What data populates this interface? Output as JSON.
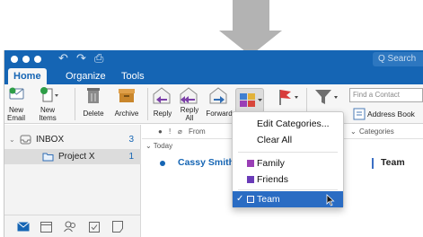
{
  "window": {
    "title_bar": {
      "search_placeholder": "Q  Search"
    },
    "tabs": [
      {
        "label": "Home"
      },
      {
        "label": "Organize"
      },
      {
        "label": "Tools"
      }
    ]
  },
  "ribbon": {
    "new_email": {
      "label1": "New",
      "label2": "Email"
    },
    "new_items": {
      "label1": "New",
      "label2": "Items"
    },
    "delete": {
      "label": "Delete"
    },
    "archive": {
      "label": "Archive"
    },
    "reply": {
      "label": "Reply"
    },
    "reply_all": {
      "label1": "Reply",
      "label2": "All"
    },
    "forward": {
      "label": "Forward"
    },
    "find_contact_placeholder": "Find a Contact",
    "address_book": {
      "label": "Address Book"
    }
  },
  "folders": {
    "items": [
      {
        "label": "INBOX",
        "count": "3"
      },
      {
        "label": "Project X",
        "count": "1"
      }
    ]
  },
  "message_list": {
    "columns": {
      "from": "From",
      "categories": "Categories"
    },
    "group_label": "Today",
    "messages": [
      {
        "from": "Cassy Smith",
        "category": "Team"
      }
    ]
  },
  "categorize_menu": {
    "items": [
      {
        "label": "Edit Categories..."
      },
      {
        "label": "Clear All"
      },
      {
        "label": "Family",
        "color": "#9a3fb6"
      },
      {
        "label": "Friends",
        "color": "#6a3bb8"
      },
      {
        "label": "Team",
        "color": "#3b6fc4",
        "checked": true,
        "checkmark": "✓"
      }
    ]
  },
  "colors": {
    "accent": "#1565b4",
    "highlight": "#2a6cc3",
    "flag_red": "#d83b3b"
  }
}
